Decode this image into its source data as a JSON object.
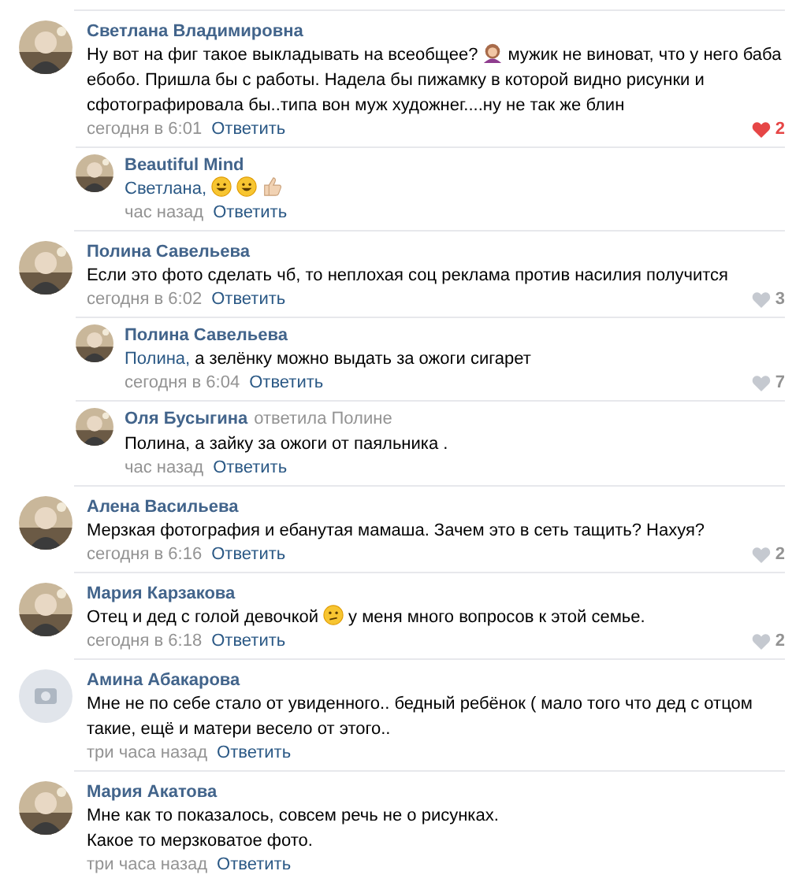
{
  "comments": [
    {
      "author": "Светлана Владимировна",
      "photo": true,
      "parts": [
        {
          "kind": "text",
          "text": "Ну вот на фиг такое выкладывать на всеобщее?"
        },
        {
          "kind": "woman"
        },
        {
          "kind": "text",
          "text": "мужик не виноват, что у него баба ебобо. Пришла бы с работы. Надела бы пижамку в которой видно рисунки и сфотографировала бы..типа вон муж художнег....ну не так же блин"
        }
      ],
      "time": "сегодня в 6:01",
      "reply": "Ответить",
      "likes": {
        "count": "2",
        "liked": true
      },
      "replies": [
        {
          "author": "Beautiful Mind",
          "photo": true,
          "parts": [
            {
              "kind": "mention",
              "text": "Светлана,"
            },
            {
              "kind": "grin"
            },
            {
              "kind": "grin"
            },
            {
              "kind": "thumb"
            }
          ],
          "time": "час назад",
          "reply": "Ответить"
        }
      ]
    },
    {
      "author": "Полина Савельева",
      "photo": true,
      "parts": [
        {
          "kind": "text",
          "text": "Если это фото сделать чб, то неплохая соц реклама против насилия получится"
        }
      ],
      "time": "сегодня в 6:02",
      "reply": "Ответить",
      "likes": {
        "count": "3",
        "liked": false
      },
      "replies": [
        {
          "author": "Полина Савельева",
          "photo": true,
          "parts": [
            {
              "kind": "mention",
              "text": "Полина,"
            },
            {
              "kind": "text",
              "text": "а зелёнку можно выдать за ожоги сигарет"
            }
          ],
          "time": "сегодня в 6:04",
          "reply": "Ответить",
          "likes": {
            "count": "7",
            "liked": false
          }
        },
        {
          "author": "Оля Бусыгина",
          "replied_to": "ответила Полине",
          "photo": true,
          "parts": [
            {
              "kind": "text",
              "text": "Полина, а зайку за ожоги от паяльника ."
            }
          ],
          "time": "час назад",
          "reply": "Ответить"
        }
      ]
    },
    {
      "author": "Алена Васильева",
      "photo": true,
      "parts": [
        {
          "kind": "text",
          "text": "Мерзкая фотография и ебанутая мамаша. Зачем это в сеть тащить? Нахуя?"
        }
      ],
      "time": "сегодня в 6:16",
      "reply": "Ответить",
      "likes": {
        "count": "2",
        "liked": false
      }
    },
    {
      "author": "Мария Карзакова",
      "photo": true,
      "parts": [
        {
          "kind": "text",
          "text": "Отец и дед с голой девочкой"
        },
        {
          "kind": "frown"
        },
        {
          "kind": "text",
          "text": "у меня много вопросов к этой семье."
        }
      ],
      "time": "сегодня в 6:18",
      "reply": "Ответить",
      "likes": {
        "count": "2",
        "liked": false
      }
    },
    {
      "author": "Амина Абакарова",
      "photo": false,
      "parts": [
        {
          "kind": "text",
          "text": "Мне не по себе стало от увиденного.. бедный ребёнок ( мало того что дед с отцом такие, ещё и матери весело от этого.."
        }
      ],
      "time": "три часа назад",
      "reply": "Ответить"
    },
    {
      "author": "Мария Акатова",
      "photo": true,
      "parts": [
        {
          "kind": "text",
          "text": "Мне как то показалось, совсем речь не о рисунках.\nКакое то мерзковатое фото."
        }
      ],
      "time": "три часа назад",
      "reply": "Ответить"
    }
  ]
}
